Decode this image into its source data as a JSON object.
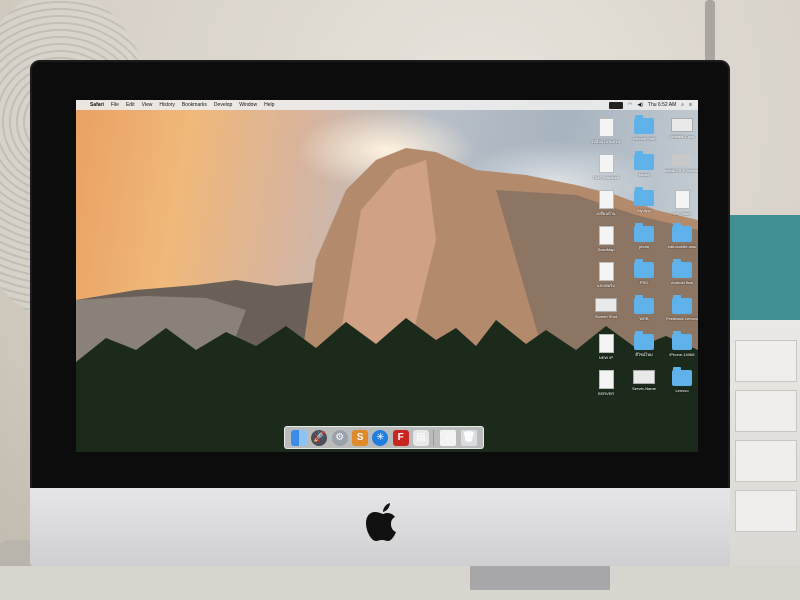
{
  "menubar": {
    "app_name": "Safari",
    "menus": [
      "File",
      "Edit",
      "View",
      "History",
      "Bookmarks",
      "Develop",
      "Window",
      "Help"
    ],
    "clock": "Thu 6:52 AM"
  },
  "desktop_icons": [
    {
      "label": "เปลี่ยนโปรแกรม",
      "kind": "doc"
    },
    {
      "label": "Lenovo Stuff",
      "kind": "folder"
    },
    {
      "label": "Untitled-1.psd",
      "kind": "shot"
    },
    {
      "label": "CMS Structure",
      "kind": "doc"
    },
    {
      "label": "Music",
      "kind": "folder"
    },
    {
      "label": "Install OS X Mavericks",
      "kind": "dmg"
    },
    {
      "label": "เปลี่ยนบ้าน",
      "kind": "doc"
    },
    {
      "label": "My App",
      "kind": "folder"
    },
    {
      "label": "OS_Store",
      "kind": "doc"
    },
    {
      "label": "ScanMap",
      "kind": "doc"
    },
    {
      "label": "photo",
      "kind": "folder"
    },
    {
      "label": "edit-bundle-mac",
      "kind": "folder"
    },
    {
      "label": "แบบฟอร์ม",
      "kind": "doc"
    },
    {
      "label": "PSD",
      "kind": "folder"
    },
    {
      "label": "Android flow",
      "kind": "folder"
    },
    {
      "label": "Screen Shot",
      "kind": "shot"
    },
    {
      "label": "WEB",
      "kind": "folder"
    },
    {
      "label": "Feedback Lenovo",
      "kind": "folder"
    },
    {
      "label": "NEW IP",
      "kind": "doc"
    },
    {
      "label": "ดีไซน์ใหม่",
      "kind": "folder"
    },
    {
      "label": "iPhone-14068",
      "kind": "folder"
    },
    {
      "label": "SERVER",
      "kind": "doc"
    },
    {
      "label": "Server-Name",
      "kind": "shot"
    },
    {
      "label": "Lenovo",
      "kind": "folder"
    }
  ],
  "dock": {
    "items": [
      {
        "name": "Finder",
        "glyph": ""
      },
      {
        "name": "Launchpad",
        "glyph": "🚀"
      },
      {
        "name": "System Preferences",
        "glyph": "⚙"
      },
      {
        "name": "Sublime Text",
        "glyph": "S"
      },
      {
        "name": "Safari",
        "glyph": "✳"
      },
      {
        "name": "FileZilla",
        "glyph": "F"
      },
      {
        "name": "Preview",
        "glyph": "▤"
      },
      {
        "name": "Downloads",
        "glyph": "↓"
      },
      {
        "name": "Trash",
        "glyph": "🗑"
      }
    ]
  },
  "colors": {
    "folder": "#5fb1ea",
    "bezel": "#0c0c0d",
    "chin": "#dcdcde"
  }
}
